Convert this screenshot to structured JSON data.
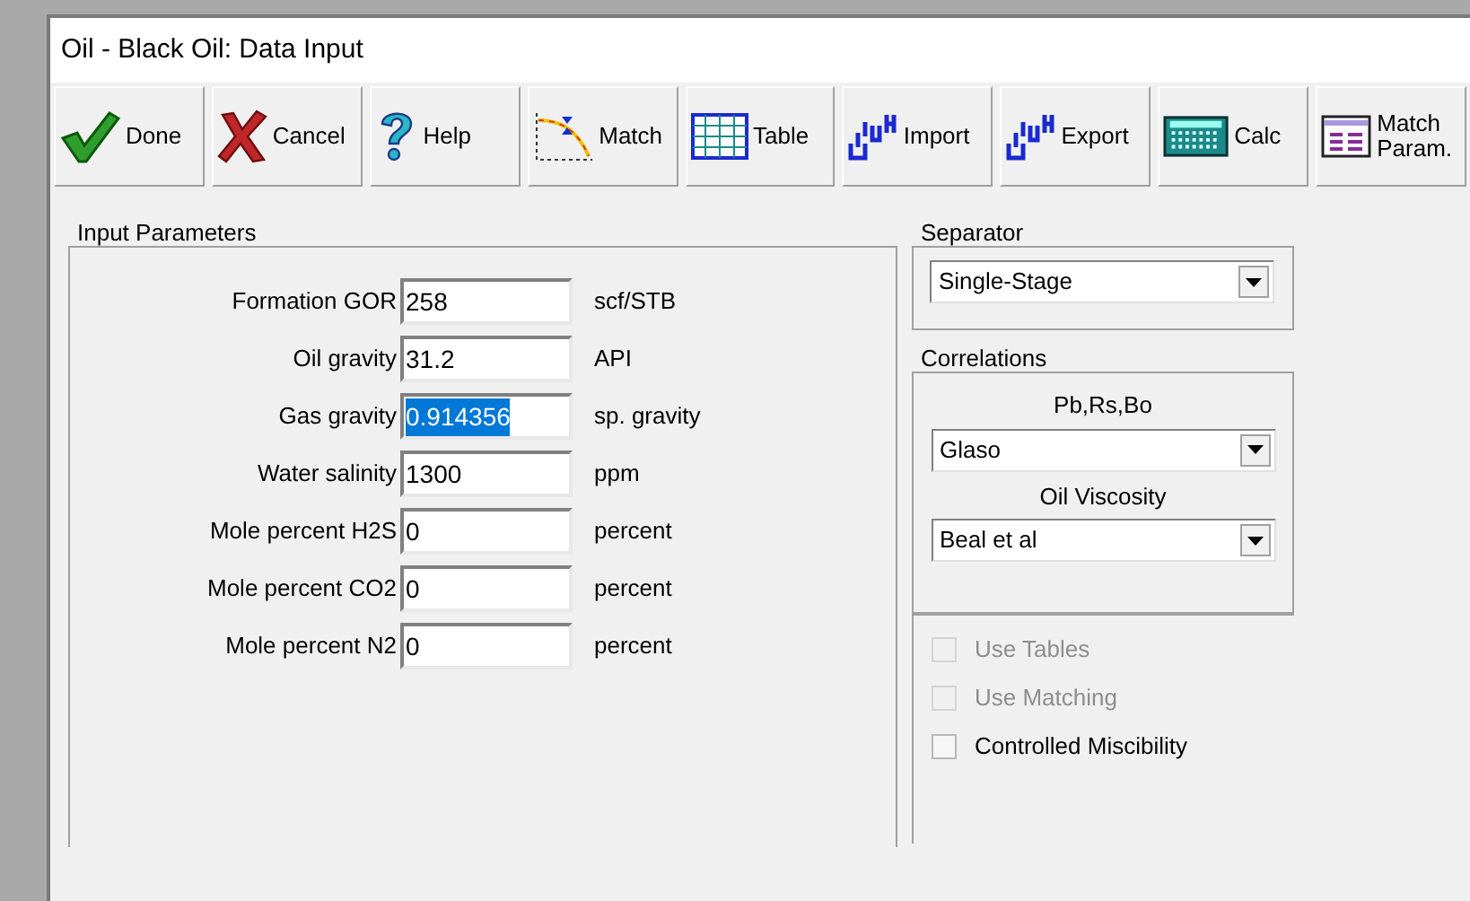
{
  "window": {
    "title": "Oil - Black Oil: Data Input"
  },
  "toolbar": [
    {
      "kind": "check",
      "label": "Done"
    },
    {
      "kind": "cross",
      "label": "Cancel"
    },
    {
      "kind": "question",
      "label": "Help"
    },
    {
      "kind": "curve",
      "label": "Match"
    },
    {
      "kind": "grid",
      "label": "Table"
    },
    {
      "kind": "data",
      "label": "Import"
    },
    {
      "kind": "data",
      "label": "Export"
    },
    {
      "kind": "calculator",
      "label": "Calc"
    },
    {
      "kind": "sheet",
      "label": "Match Param."
    }
  ],
  "input_parameters": {
    "title": "Input Parameters",
    "fields": [
      {
        "label": "Formation GOR",
        "value": "258",
        "unit": "scf/STB",
        "selected": false
      },
      {
        "label": "Oil gravity",
        "value": "31.2",
        "unit": "API",
        "selected": false
      },
      {
        "label": "Gas gravity",
        "value": "0.914356",
        "unit": "sp. gravity",
        "selected": true
      },
      {
        "label": "Water salinity",
        "value": "1300",
        "unit": "ppm",
        "selected": false
      },
      {
        "label": "Mole percent H2S",
        "value": "0",
        "unit": "percent",
        "selected": false
      },
      {
        "label": "Mole percent CO2",
        "value": "0",
        "unit": "percent",
        "selected": false
      },
      {
        "label": "Mole percent N2",
        "value": "0",
        "unit": "percent",
        "selected": false
      }
    ]
  },
  "separator": {
    "title": "Separator",
    "value": "Single-Stage"
  },
  "correlations": {
    "title": "Correlations",
    "dropdowns": [
      {
        "label": "Pb,Rs,Bo",
        "value": "Glaso"
      },
      {
        "label": "Oil Viscosity",
        "value": "Beal et al"
      }
    ]
  },
  "options": [
    {
      "label": "Use Tables",
      "checked": false,
      "disabled": true
    },
    {
      "label": "Use Matching",
      "checked": false,
      "disabled": true
    },
    {
      "label": "Controlled Miscibility",
      "checked": false,
      "disabled": false
    }
  ]
}
